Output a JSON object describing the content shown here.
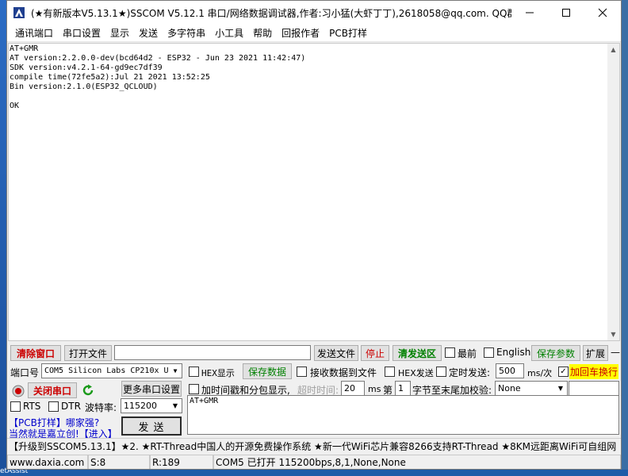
{
  "window": {
    "title": "(★有新版本V5.13.1★)SSCOM V5.12.1 串口/网络数据调试器,作者:习小猛(大虾丁丁),2618058@qq.com. QQ群..."
  },
  "menu": [
    "通讯端口",
    "串口设置",
    "显示",
    "发送",
    "多字符串",
    "小工具",
    "帮助",
    "回报作者",
    "PCB打样"
  ],
  "receive": {
    "lines": [
      "AT+GMR",
      "AT version:2.2.0.0-dev(bcd64d2 - ESP32 - Jun 23 2021 11:42:47)",
      "SDK version:v4.2.1-64-gd9ec7df39",
      "compile time(72fe5a2):Jul 21 2021 13:52:25",
      "Bin version:2.1.0(ESP32_QCLOUD)",
      "",
      "OK"
    ]
  },
  "row1": {
    "clear_window": "清除窗口",
    "open_file": "打开文件",
    "file_path": "",
    "send_file": "发送文件",
    "stop": "停止",
    "clear_send": "清发送区",
    "topmost": "最前",
    "english": "English",
    "save_params": "保存参数",
    "expand": "扩展",
    "dash": "—"
  },
  "row2": {
    "port_label": "端口号",
    "port_value": "COM5 Silicon Labs CP210x U",
    "hex_display": "HEX显示",
    "save_data": "保存数据",
    "recv_to_file": "接收数据到文件",
    "hex_send": "HEX发送",
    "timed_send": "定时发送:",
    "interval": "500",
    "interval_unit": "ms/次",
    "add_crlf": "加回车换行"
  },
  "row3": {
    "close_port": "关闭串口",
    "more_settings": "更多串口设置",
    "timestamp": "加时间戳和分包显示,",
    "timeout_label": "超时时间:",
    "timeout_value": "20",
    "timeout_unit": "ms",
    "byte_prefix": "第",
    "byte_index": "1",
    "byte_suffix": "字节至末尾加校验:",
    "checksum": "None"
  },
  "row4": {
    "rts": "RTS",
    "dtr": "DTR",
    "baud_label": "波特率:",
    "baud_value": "115200",
    "send_text": "AT+GMR"
  },
  "promo": {
    "line1": "【PCB打样】哪家强?",
    "line2": "当然就是嘉立创!【进入】"
  },
  "send_button": "发  送",
  "ticker": "【升级到SSCOM5.13.1】★2. ★RT-Thread中国人的开源免费操作系统 ★新一代WiFi芯片兼容8266支持RT-Thread ★8KM远距离WiFi可自组网",
  "status": {
    "website": "www.daxia.com",
    "sent": "S:8",
    "received": "R:189",
    "port_info": "COM5 已打开  115200bps,8,1,None,None"
  },
  "desktop": {
    "taskbar_hint": "etAssist"
  },
  "colors": {
    "green_text": "#008000",
    "red_text": "#cc0000",
    "highlight_yellow": "#ffff00"
  }
}
